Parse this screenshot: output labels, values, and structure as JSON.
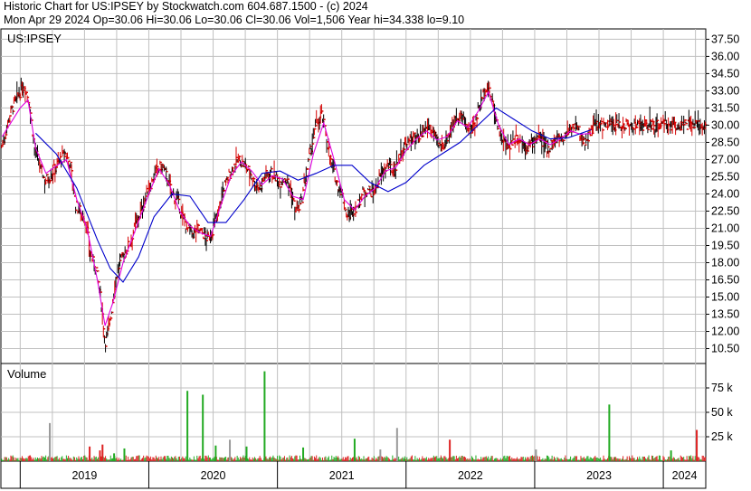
{
  "header": {
    "line1": "Historic Chart for US:IPSEY by Stockwatch.com 604.687.1500 - (c) 2024",
    "line2": "Mon Apr 29 2024   Op=30.06   Hi=30.06   Lo=30.06   Cl=30.06   Vol=1,506   Year hi=34.338   lo=9.10"
  },
  "colors": {
    "price": "#d40000",
    "ma_short": "#e000e0",
    "ma_long": "#0000cc",
    "vol_up": "#22aa22",
    "vol_down": "#dd2222",
    "vol_neutral": "#999999",
    "grid": "#c0c0c0"
  },
  "chart_data": [
    {
      "type": "line",
      "panel": "price",
      "label": "US:IPSEY",
      "y_ticks": [
        "37.50",
        "36.00",
        "34.50",
        "33.00",
        "31.50",
        "30.00",
        "28.50",
        "27.00",
        "25.50",
        "24.00",
        "22.50",
        "21.00",
        "19.50",
        "18.00",
        "16.50",
        "15.00",
        "13.50",
        "12.00",
        "10.50"
      ],
      "ylim": [
        9.2,
        38.4
      ],
      "x_labels": [
        "2019",
        "2020",
        "2021",
        "2022",
        "2023",
        "2024"
      ],
      "x_range": [
        2018.85,
        2024.33
      ],
      "grid": true,
      "series": [
        {
          "points": [
            [
              2018.86,
              28.2
            ],
            [
              2018.92,
              31.0
            ],
            [
              2018.98,
              32.5
            ],
            [
              2019.03,
              33.5
            ],
            [
              2019.07,
              32.0
            ],
            [
              2019.11,
              28.0
            ],
            [
              2019.15,
              26.5
            ],
            [
              2019.19,
              25.2
            ],
            [
              2019.23,
              25.5
            ],
            [
              2019.27,
              26.3
            ],
            [
              2019.31,
              27.0
            ],
            [
              2019.35,
              27.5
            ],
            [
              2019.39,
              26.5
            ],
            [
              2019.43,
              23.0
            ],
            [
              2019.47,
              22.5
            ],
            [
              2019.51,
              21.5
            ],
            [
              2019.55,
              18.5
            ],
            [
              2019.59,
              17.5
            ],
            [
              2019.63,
              14.5
            ],
            [
              2019.66,
              11.0
            ],
            [
              2019.7,
              13.0
            ],
            [
              2019.74,
              16.5
            ],
            [
              2019.78,
              18.2
            ],
            [
              2019.82,
              19.0
            ],
            [
              2019.86,
              20.0
            ],
            [
              2019.9,
              21.5
            ],
            [
              2019.94,
              22.5
            ],
            [
              2019.98,
              24.0
            ],
            [
              2020.02,
              25.0
            ],
            [
              2020.06,
              26.0
            ],
            [
              2020.1,
              26.5
            ],
            [
              2020.14,
              25.5
            ],
            [
              2020.18,
              24.0
            ],
            [
              2020.22,
              23.5
            ],
            [
              2020.26,
              22.0
            ],
            [
              2020.3,
              21.0
            ],
            [
              2020.34,
              20.5
            ],
            [
              2020.38,
              21.0
            ],
            [
              2020.42,
              20.5
            ],
            [
              2020.46,
              20.0
            ],
            [
              2020.5,
              21.0
            ],
            [
              2020.54,
              22.5
            ],
            [
              2020.58,
              24.5
            ],
            [
              2020.62,
              25.5
            ],
            [
              2020.66,
              26.5
            ],
            [
              2020.7,
              27.0
            ],
            [
              2020.74,
              26.5
            ],
            [
              2020.78,
              26.0
            ],
            [
              2020.82,
              25.0
            ],
            [
              2020.86,
              24.5
            ],
            [
              2020.9,
              25.5
            ],
            [
              2020.94,
              26.0
            ],
            [
              2020.98,
              25.5
            ],
            [
              2021.02,
              25.0
            ],
            [
              2021.06,
              25.5
            ],
            [
              2021.1,
              24.5
            ],
            [
              2021.14,
              22.5
            ],
            [
              2021.18,
              23.0
            ],
            [
              2021.22,
              25.5
            ],
            [
              2021.26,
              28.0
            ],
            [
              2021.3,
              30.0
            ],
            [
              2021.34,
              31.0
            ],
            [
              2021.38,
              29.0
            ],
            [
              2021.42,
              26.5
            ],
            [
              2021.46,
              25.0
            ],
            [
              2021.5,
              24.0
            ],
            [
              2021.54,
              22.0
            ],
            [
              2021.58,
              22.5
            ],
            [
              2021.62,
              23.0
            ],
            [
              2021.66,
              24.0
            ],
            [
              2021.7,
              24.5
            ],
            [
              2021.74,
              24.0
            ],
            [
              2021.78,
              25.0
            ],
            [
              2021.82,
              26.0
            ],
            [
              2021.86,
              26.5
            ],
            [
              2021.9,
              26.0
            ],
            [
              2021.94,
              27.0
            ],
            [
              2021.98,
              28.0
            ],
            [
              2022.02,
              28.5
            ],
            [
              2022.06,
              29.0
            ],
            [
              2022.1,
              28.5
            ],
            [
              2022.14,
              29.5
            ],
            [
              2022.18,
              30.0
            ],
            [
              2022.22,
              29.0
            ],
            [
              2022.26,
              28.0
            ],
            [
              2022.3,
              28.5
            ],
            [
              2022.34,
              29.5
            ],
            [
              2022.38,
              30.5
            ],
            [
              2022.42,
              31.0
            ],
            [
              2022.46,
              30.0
            ],
            [
              2022.5,
              29.5
            ],
            [
              2022.54,
              30.5
            ],
            [
              2022.58,
              32.0
            ],
            [
              2022.62,
              33.5
            ],
            [
              2022.66,
              32.5
            ],
            [
              2022.7,
              30.5
            ],
            [
              2022.74,
              29.0
            ],
            [
              2022.78,
              28.0
            ],
            [
              2022.82,
              28.5
            ],
            [
              2022.86,
              29.0
            ],
            [
              2022.9,
              28.5
            ],
            [
              2022.94,
              28.0
            ],
            [
              2022.98,
              28.5
            ],
            [
              2023.02,
              29.0
            ],
            [
              2023.06,
              28.5
            ],
            [
              2023.1,
              28.0
            ],
            [
              2023.14,
              28.5
            ],
            [
              2023.18,
              28.8
            ],
            [
              2023.22,
              29.0
            ],
            [
              2023.26,
              29.5
            ],
            [
              2023.3,
              30.0
            ],
            [
              2023.34,
              29.5
            ],
            [
              2023.38,
              28.5
            ],
            [
              2023.42,
              29.0
            ],
            [
              2023.46,
              30.0
            ]
          ]
        },
        {
          "points": [
            [
              2018.86,
              29.0
            ],
            [
              2019.0,
              31.5
            ],
            [
              2019.06,
              32.2
            ],
            [
              2019.12,
              28.0
            ],
            [
              2019.2,
              25.8
            ],
            [
              2019.3,
              26.6
            ],
            [
              2019.36,
              27.0
            ],
            [
              2019.44,
              23.5
            ],
            [
              2019.52,
              21.0
            ],
            [
              2019.6,
              16.5
            ],
            [
              2019.66,
              12.5
            ],
            [
              2019.72,
              14.5
            ],
            [
              2019.8,
              18.0
            ],
            [
              2019.9,
              21.0
            ],
            [
              2020.0,
              24.0
            ],
            [
              2020.08,
              26.2
            ],
            [
              2020.16,
              24.8
            ],
            [
              2020.24,
              22.5
            ],
            [
              2020.32,
              21.2
            ],
            [
              2020.4,
              20.6
            ],
            [
              2020.48,
              20.3
            ],
            [
              2020.56,
              23.0
            ],
            [
              2020.64,
              25.6
            ],
            [
              2020.72,
              26.8
            ],
            [
              2020.8,
              26.0
            ],
            [
              2020.88,
              24.8
            ],
            [
              2020.96,
              25.6
            ],
            [
              2021.04,
              25.3
            ],
            [
              2021.12,
              23.8
            ],
            [
              2021.2,
              23.5
            ],
            [
              2021.28,
              27.5
            ],
            [
              2021.36,
              30.2
            ],
            [
              2021.44,
              27.0
            ],
            [
              2021.52,
              23.5
            ],
            [
              2021.6,
              22.6
            ],
            [
              2021.68,
              23.8
            ],
            [
              2021.76,
              24.5
            ],
            [
              2021.84,
              26.0
            ],
            [
              2021.92,
              26.3
            ],
            [
              2022.0,
              27.8
            ],
            [
              2022.08,
              28.8
            ],
            [
              2022.16,
              29.5
            ],
            [
              2022.24,
              28.7
            ],
            [
              2022.32,
              29.0
            ],
            [
              2022.4,
              30.4
            ],
            [
              2022.48,
              29.8
            ],
            [
              2022.56,
              31.2
            ],
            [
              2022.64,
              32.9
            ],
            [
              2022.72,
              30.0
            ],
            [
              2022.8,
              28.3
            ],
            [
              2022.88,
              28.8
            ],
            [
              2022.96,
              28.3
            ],
            [
              2023.04,
              28.8
            ],
            [
              2023.12,
              28.3
            ],
            [
              2023.2,
              28.8
            ],
            [
              2023.28,
              29.5
            ],
            [
              2023.36,
              29.2
            ],
            [
              2023.44,
              29.3
            ]
          ]
        },
        {
          "points": [
            [
              2019.12,
              29.3
            ],
            [
              2019.28,
              27.5
            ],
            [
              2019.44,
              24.5
            ],
            [
              2019.6,
              20.0
            ],
            [
              2019.7,
              17.5
            ],
            [
              2019.8,
              16.3
            ],
            [
              2019.92,
              18.5
            ],
            [
              2020.04,
              22.0
            ],
            [
              2020.18,
              24.0
            ],
            [
              2020.32,
              23.8
            ],
            [
              2020.46,
              21.5
            ],
            [
              2020.6,
              21.5
            ],
            [
              2020.74,
              23.5
            ],
            [
              2020.88,
              25.8
            ],
            [
              2021.02,
              26.0
            ],
            [
              2021.16,
              25.2
            ],
            [
              2021.3,
              25.8
            ],
            [
              2021.44,
              26.5
            ],
            [
              2021.58,
              26.5
            ],
            [
              2021.72,
              25.0
            ],
            [
              2021.86,
              24.2
            ],
            [
              2022.0,
              25.0
            ],
            [
              2022.14,
              26.5
            ],
            [
              2022.28,
              27.5
            ],
            [
              2022.42,
              28.5
            ],
            [
              2022.56,
              30.0
            ],
            [
              2022.7,
              31.5
            ],
            [
              2022.84,
              30.5
            ],
            [
              2022.98,
              29.5
            ],
            [
              2023.12,
              28.8
            ],
            [
              2023.26,
              28.9
            ],
            [
              2023.44,
              29.6
            ]
          ]
        }
      ]
    },
    {
      "type": "bar",
      "panel": "volume",
      "label": "Volume",
      "y_ticks": [
        "75 k",
        "50 k",
        "25 k"
      ],
      "ylim": [
        0,
        100
      ],
      "grid": true,
      "spikes": [
        {
          "x": 2019.23,
          "v": 39,
          "dir": "neutral"
        },
        {
          "x": 2019.54,
          "v": 15,
          "dir": "down"
        },
        {
          "x": 2019.62,
          "v": 11,
          "dir": "down"
        },
        {
          "x": 2019.64,
          "v": 17,
          "dir": "down"
        },
        {
          "x": 2019.73,
          "v": 8,
          "dir": "up"
        },
        {
          "x": 2019.81,
          "v": 13,
          "dir": "up"
        },
        {
          "x": 2020.3,
          "v": 72,
          "dir": "up"
        },
        {
          "x": 2020.42,
          "v": 68,
          "dir": "up"
        },
        {
          "x": 2020.52,
          "v": 16,
          "dir": "up"
        },
        {
          "x": 2020.63,
          "v": 22,
          "dir": "neutral"
        },
        {
          "x": 2020.76,
          "v": 15,
          "dir": "up"
        },
        {
          "x": 2020.9,
          "v": 92,
          "dir": "up"
        },
        {
          "x": 2021.2,
          "v": 14,
          "dir": "up"
        },
        {
          "x": 2021.6,
          "v": 23,
          "dir": "up"
        },
        {
          "x": 2021.8,
          "v": 12,
          "dir": "neutral"
        },
        {
          "x": 2021.93,
          "v": 34,
          "dir": "neutral"
        },
        {
          "x": 2022.34,
          "v": 22,
          "dir": "down"
        },
        {
          "x": 2023.01,
          "v": 12,
          "dir": "neutral"
        },
        {
          "x": 2023.58,
          "v": 58,
          "dir": "up"
        },
        {
          "x": 2024.06,
          "v": 11,
          "dir": "up"
        },
        {
          "x": 2024.26,
          "v": 32,
          "dir": "down"
        }
      ]
    }
  ]
}
